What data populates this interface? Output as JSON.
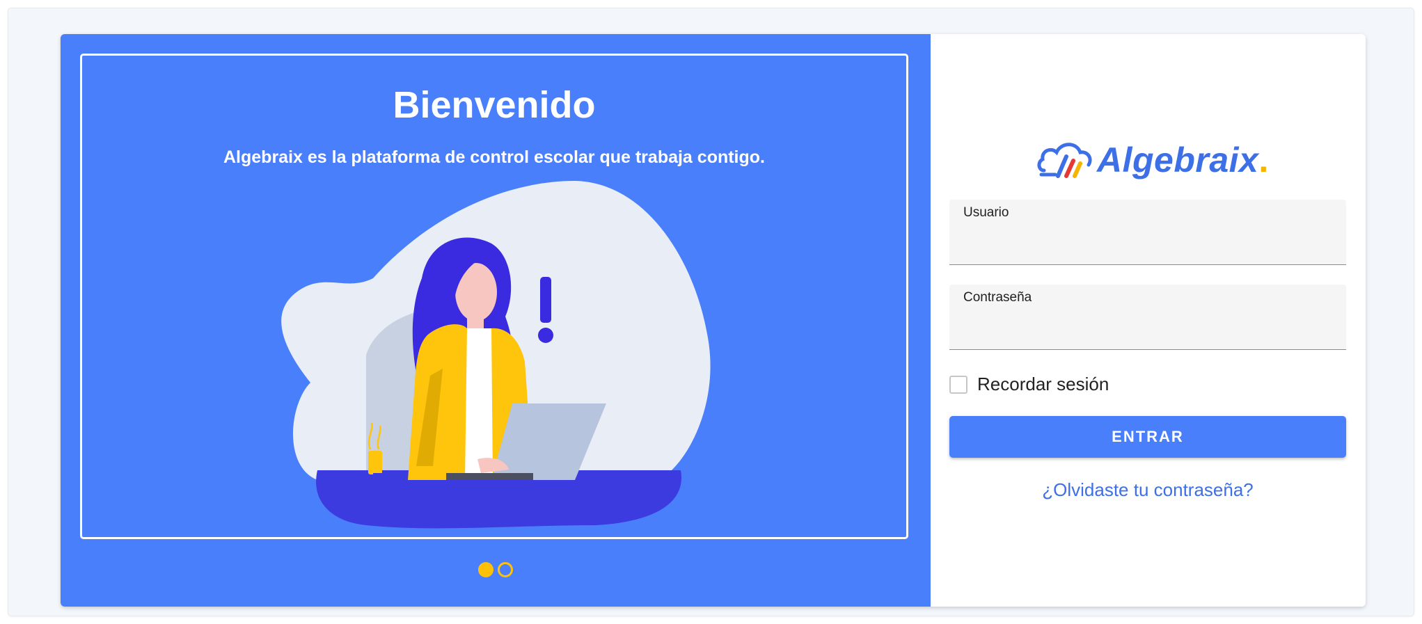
{
  "welcome": {
    "title": "Bienvenido",
    "subtitle": "Algebraix es la plataforma de control escolar que trabaja contigo."
  },
  "carousel": {
    "slide_count": 2,
    "active_index": 0
  },
  "brand": {
    "name": "Algebraix",
    "primary_color": "#4a7ffb",
    "accent_color": "#ffc107"
  },
  "login": {
    "username_label": "Usuario",
    "username_value": "",
    "password_label": "Contraseña",
    "password_value": "",
    "remember_label": "Recordar sesión",
    "remember_checked": false,
    "submit_label": "ENTRAR",
    "forgot_label": "¿Olvidaste tu contraseña?"
  }
}
